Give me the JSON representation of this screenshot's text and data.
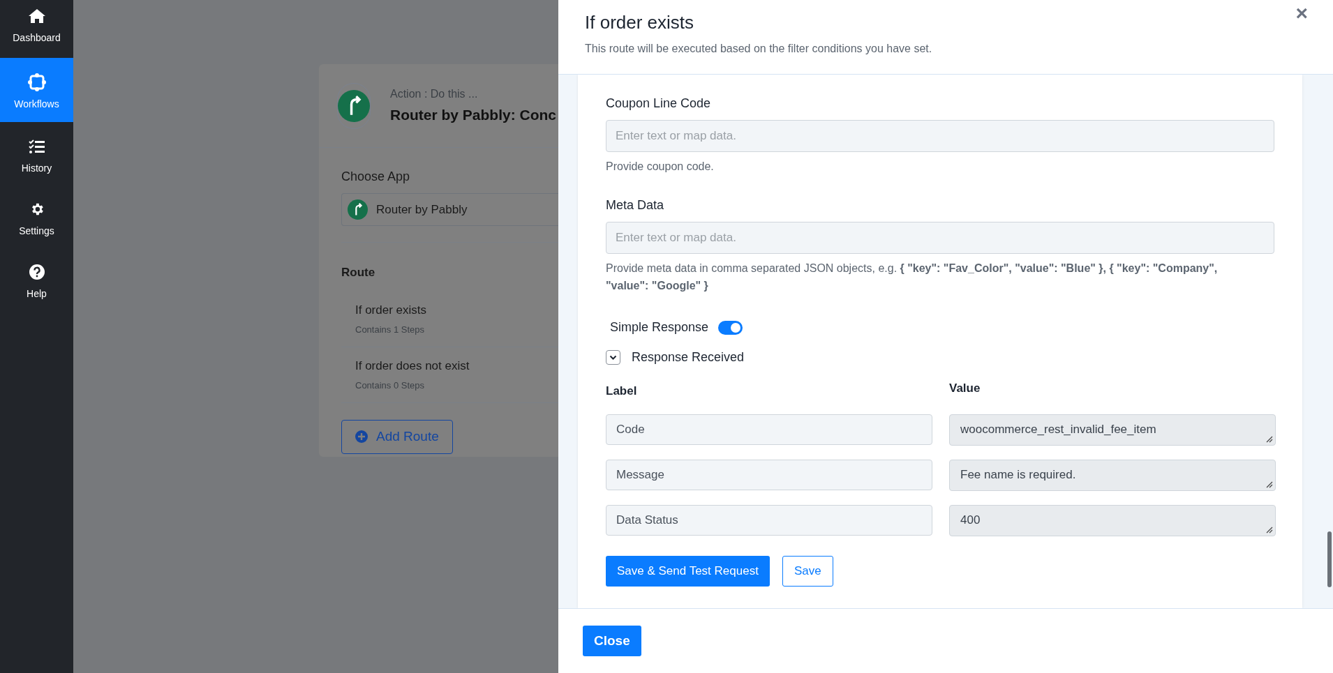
{
  "sidebar": {
    "items": [
      {
        "kind": "home",
        "label": "Dashboard",
        "selected": false
      },
      {
        "kind": "workflow",
        "label": "Workflows",
        "selected": true
      },
      {
        "kind": "history",
        "label": "History",
        "selected": false
      },
      {
        "kind": "settings",
        "label": "Settings",
        "selected": false
      },
      {
        "kind": "help",
        "label": "Help",
        "selected": false
      }
    ]
  },
  "action_card": {
    "subtitle": "Action : Do this ...",
    "title": "Router by Pabbly: Conc",
    "choose_app_label": "Choose App",
    "app": "Router by Pabbly",
    "route_heading": "Route",
    "routes": [
      {
        "name": "If order exists",
        "steps": "Contains 1 Steps"
      },
      {
        "name": "If order does not exist",
        "steps": "Contains 0 Steps"
      }
    ],
    "add_button": "Add Route"
  },
  "modal": {
    "title": "If order exists",
    "subtitle": "This route will be executed based on the filter conditions you have set.",
    "close_icon": "×",
    "fields": [
      {
        "label": "Coupon Line Code",
        "placeholder": "Enter text or map data.",
        "help": "Provide coupon code."
      },
      {
        "label": "Meta Data",
        "placeholder": "Enter text or map data.",
        "help": "Provide meta data in comma separated JSON objects, e.g. **{ \"key\": \"Fav_Color\", \"value\": \"Blue\" }, { \"key\": \"Company\", \"value\": \"Google\" }**"
      }
    ],
    "simple_response": {
      "label": "Simple Response",
      "on": true
    },
    "response_received": {
      "label": "Response Received",
      "expanded": true
    },
    "columns": [
      "Label",
      "Value"
    ],
    "rows": [
      {
        "label": "Code",
        "value": "woocommerce_rest_invalid_fee_item"
      },
      {
        "label": "Message",
        "value": "Fee name is required."
      },
      {
        "label": "Data Status",
        "value": "400"
      }
    ],
    "buttons": [
      "Save & Send Test Request",
      "Save"
    ],
    "footer_button": "Close"
  }
}
